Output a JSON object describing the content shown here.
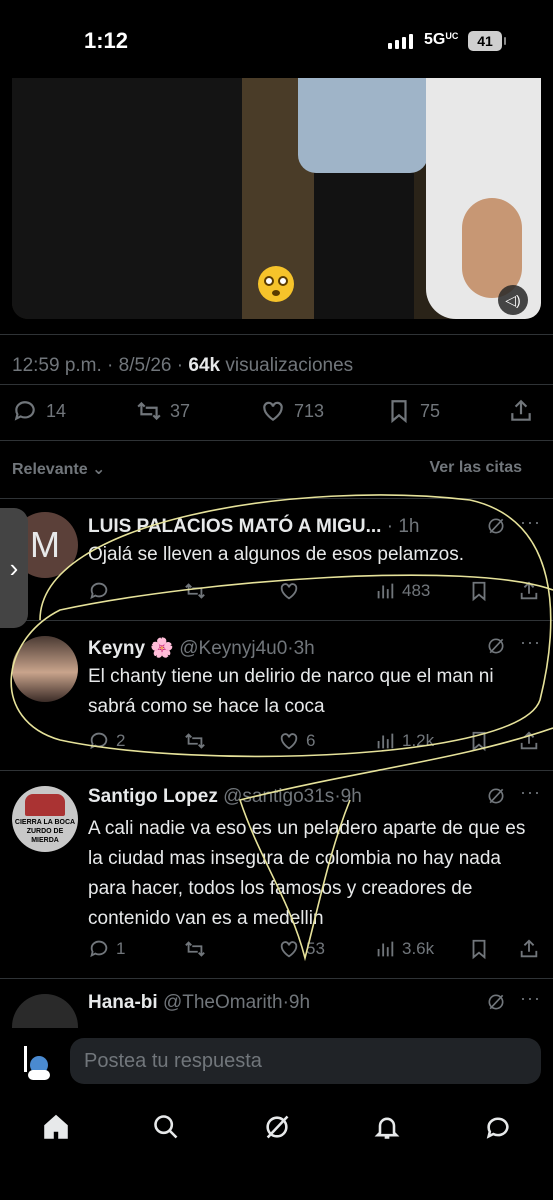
{
  "status_bar": {
    "time": "1:12",
    "network": "5G",
    "network_suffix": "UC",
    "battery": "41"
  },
  "tweet": {
    "time": "12:59 p.m.",
    "date": "8/5/26",
    "views_count": "64k",
    "views_label": "visualizaciones",
    "replies": "14",
    "reposts": "37",
    "likes": "713",
    "bookmarks": "75"
  },
  "sort": {
    "label": "Relevante",
    "quotes_link": "Ver las citas"
  },
  "replies": [
    {
      "name": "LUIS PALACIOS MATÓ A MIGU...",
      "handle": "",
      "time": "1h",
      "avatar_letter": "M",
      "text": "Ojalá se lleven a algunos de esos pelamzos.",
      "reply_count": "",
      "repost_count": "",
      "like_count": "",
      "views": "483"
    },
    {
      "name": "Keyny 🌸",
      "handle": "@Keynyj4u0",
      "time": "3h",
      "text": "El chanty tiene un delirio de narco que el man ni sabrá como se hace la coca",
      "reply_count": "2",
      "repost_count": "",
      "like_count": "6",
      "views": "1.2k"
    },
    {
      "name": "Santigo Lopez",
      "handle": "@santigo31s",
      "time": "9h",
      "avatar_text_1": "CIERRA LA BOCA",
      "avatar_text_2": "ZURDO DE MIERDA",
      "text": "A cali nadie va eso es un peladero aparte de que es la ciudad mas insegura de colombia no hay nada para hacer, todos los famosos y creadores de contenido  van es a medellin",
      "reply_count": "1",
      "repost_count": "",
      "like_count": "53",
      "views": "3.6k"
    },
    {
      "name": "Hana-bi",
      "handle": "@TheOmarith",
      "time": "9h"
    }
  ],
  "composer": {
    "placeholder": "Postea tu respuesta"
  },
  "icons": [
    "reply-icon",
    "repost-icon",
    "like-icon",
    "bookmark-icon",
    "share-icon",
    "views-icon",
    "grok-icon",
    "home-icon",
    "search-icon",
    "notifications-icon",
    "messages-icon"
  ],
  "colors": {
    "background": "#000000",
    "text": "#e7e9ea",
    "muted": "#71767b",
    "annotation": "#e6e29a"
  }
}
